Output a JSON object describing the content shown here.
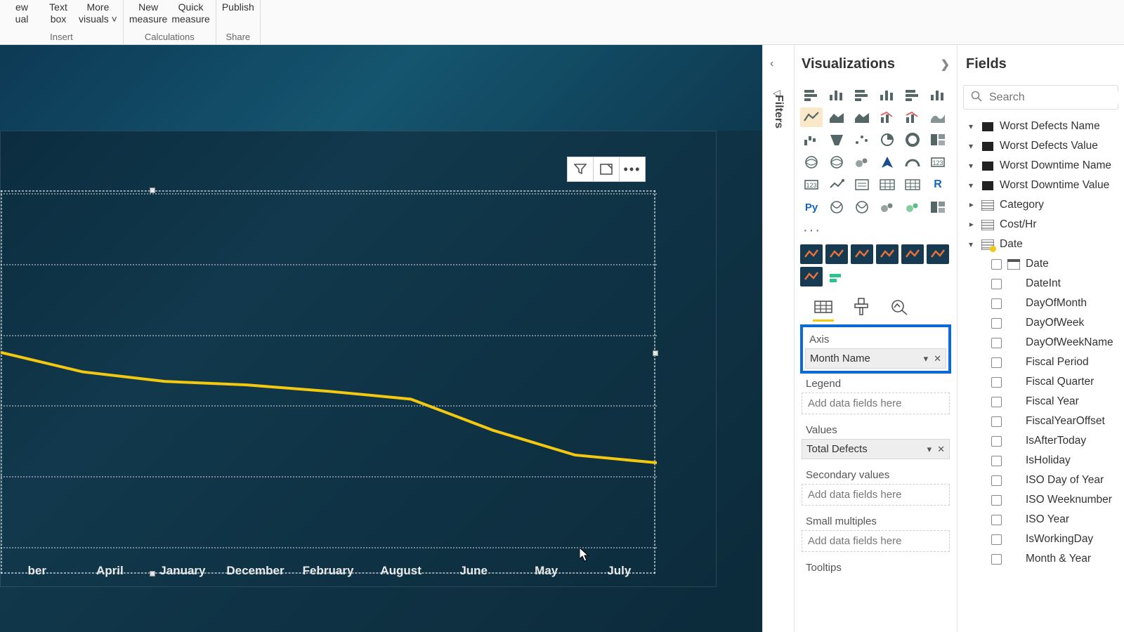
{
  "ribbon": {
    "insert": {
      "label": "Insert",
      "items": [
        "ew\nual",
        "Text\nbox",
        "More\nvisuals ˅"
      ]
    },
    "calculations": {
      "label": "Calculations",
      "items": [
        "New\nmeasure",
        "Quick\nmeasure"
      ]
    },
    "share": {
      "label": "Share",
      "items": [
        "Publish"
      ]
    }
  },
  "filtersRail": {
    "label": "Filters"
  },
  "viz": {
    "title": "Visualizations",
    "ellipsis": "···",
    "tabLabels": {
      "fields": "fields-tab",
      "format": "format-tab",
      "analytics": "analytics-tab"
    },
    "wells": {
      "axis": {
        "label": "Axis",
        "value": "Month Name"
      },
      "legend": {
        "label": "Legend",
        "placeholder": "Add data fields here"
      },
      "values": {
        "label": "Values",
        "value": "Total Defects"
      },
      "secondary": {
        "label": "Secondary values",
        "placeholder": "Add data fields here"
      },
      "multiples": {
        "label": "Small multiples",
        "placeholder": "Add data fields here"
      },
      "tooltips": {
        "label": "Tooltips"
      }
    }
  },
  "fields": {
    "title": "Fields",
    "searchPlaceholder": "Search",
    "topTables": [
      "Worst Defects Name",
      "Worst Defects Value",
      "Worst Downtime Name",
      "Worst Downtime Value"
    ],
    "midTables": [
      "Category",
      "Cost/Hr"
    ],
    "dateTable": "Date",
    "dateFields": [
      "Date",
      "DateInt",
      "DayOfMonth",
      "DayOfWeek",
      "DayOfWeekName",
      "Fiscal Period",
      "Fiscal Quarter",
      "Fiscal Year",
      "FiscalYearOffset",
      "IsAfterToday",
      "IsHoliday",
      "ISO Day of Year",
      "ISO Weeknumber",
      "ISO Year",
      "IsWorkingDay",
      "Month & Year"
    ]
  },
  "chart_data": {
    "type": "line",
    "title": "",
    "xlabel": "",
    "ylabel": "",
    "categories": [
      "ber",
      "April",
      "January",
      "December",
      "February",
      "August",
      "June",
      "May",
      "July"
    ],
    "values": [
      550,
      495,
      468,
      458,
      440,
      418,
      330,
      260,
      238
    ],
    "ylim": [
      0,
      1000
    ],
    "grid": true,
    "series_color": "#f2c811"
  }
}
